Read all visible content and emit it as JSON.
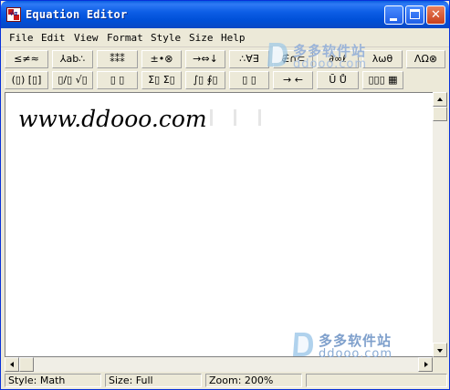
{
  "window": {
    "title": "Equation Editor",
    "icon_text": "√α"
  },
  "title_buttons": {
    "minimize": "minimize",
    "maximize": "maximize",
    "close": "✕"
  },
  "menu": [
    "File",
    "Edit",
    "View",
    "Format",
    "Style",
    "Size",
    "Help"
  ],
  "palettes": {
    "row1": [
      "≤≠≈",
      "⅄ab∴",
      "⁑⁑⁑",
      "±•⊗",
      "→⇔↓",
      "∴∀∃",
      "∉∩⊂",
      "∂∞ℓ",
      "λωθ",
      "ΛΩ⊗"
    ],
    "row2": [
      "(▯) [▯]",
      "▯/▯ √▯",
      "▯ ▯",
      "Σ▯ Σ▯",
      "∫▯ ∮▯",
      "▯ ▯",
      "→ ←",
      "Ū Ů",
      "▯▯▯ ▦"
    ]
  },
  "watermark": {
    "cn": "多多软件站",
    "en": "ddooo.com"
  },
  "editor": {
    "content": "www.ddooo.com"
  },
  "status": {
    "style": "Style: Math",
    "size": "Size: Full",
    "zoom": "Zoom: 200%"
  },
  "colors": {
    "titlebar": "#0a5fe0",
    "chrome": "#ece9d8",
    "close_button": "#c8401c"
  }
}
